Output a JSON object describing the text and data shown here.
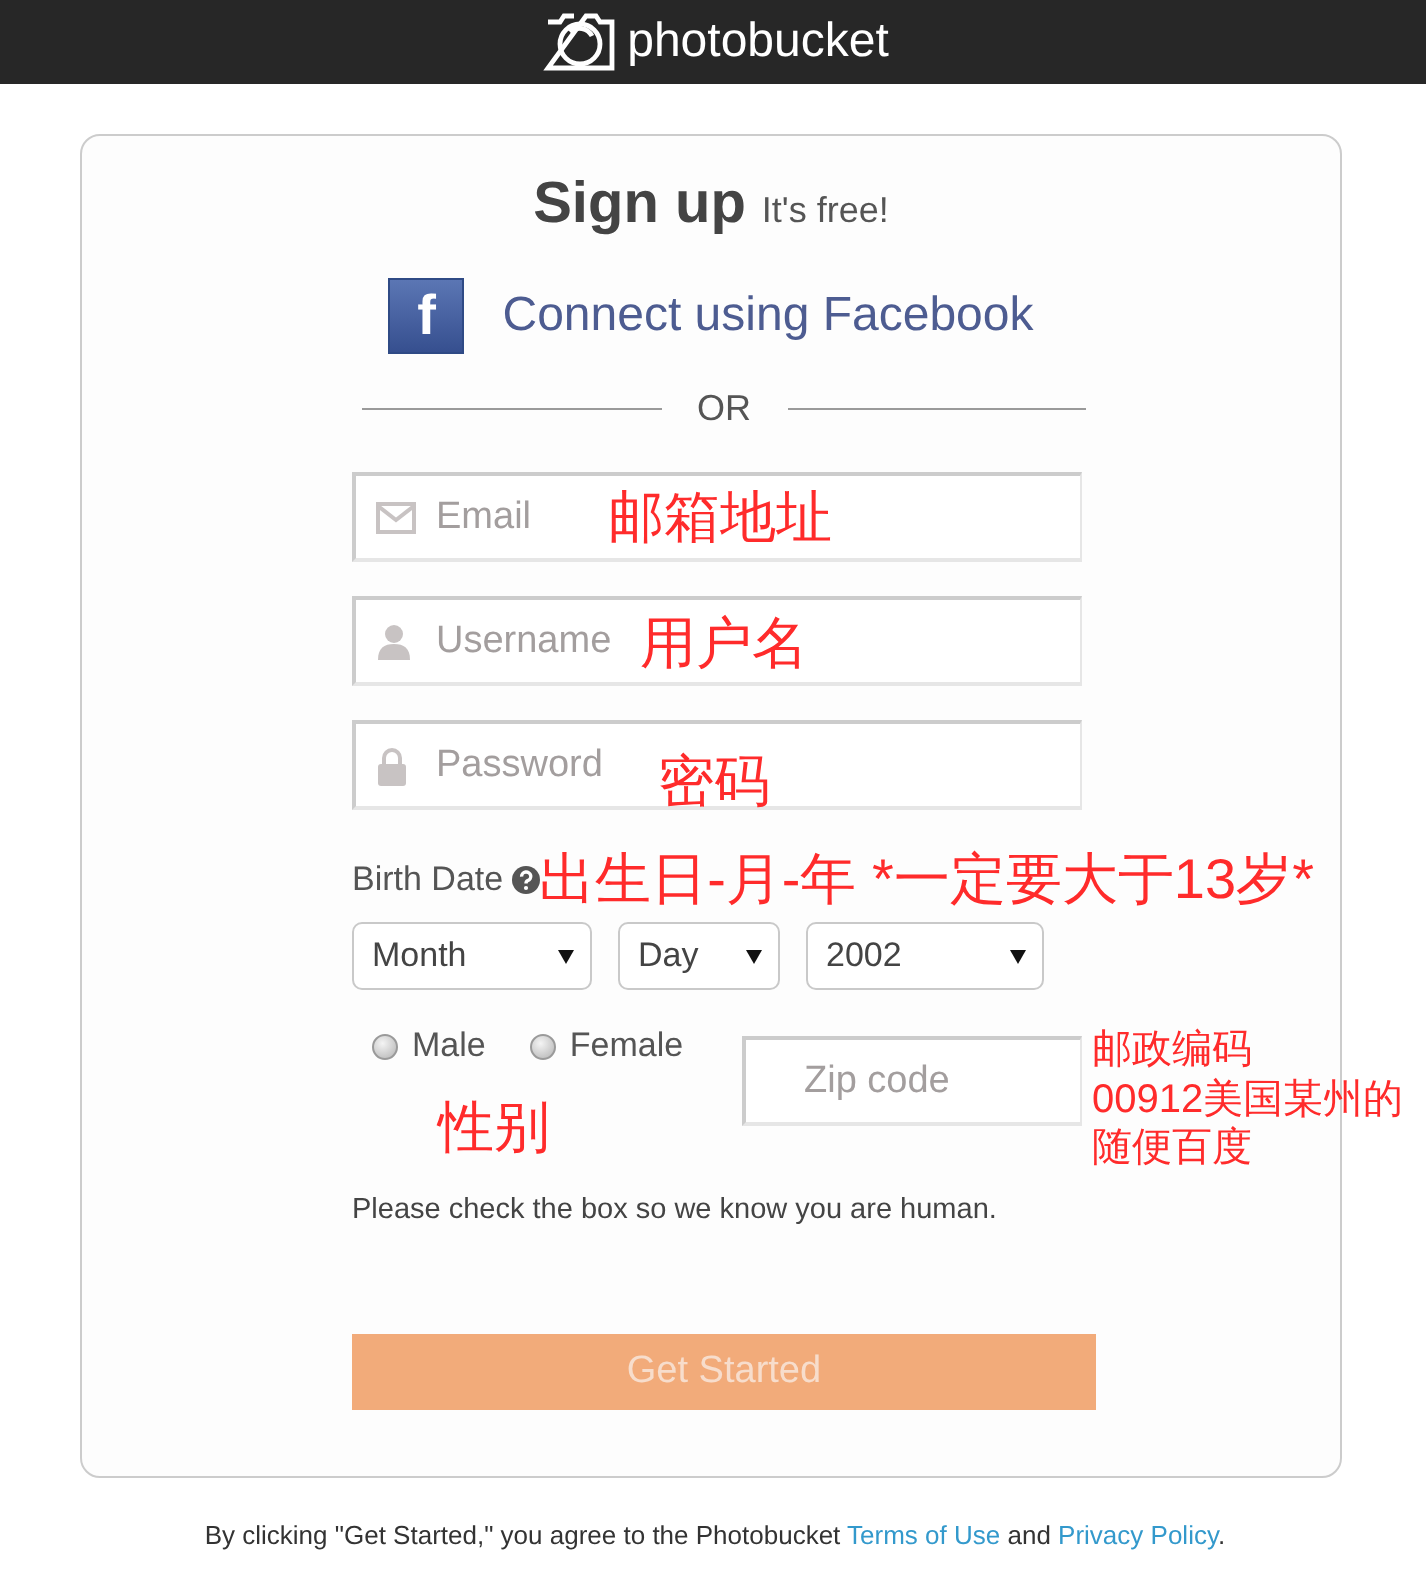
{
  "header": {
    "logo_text": "photobucket"
  },
  "signup": {
    "title": "Sign up",
    "subtitle": "It's free!"
  },
  "facebook": {
    "icon_letter": "f",
    "label": "Connect using Facebook"
  },
  "divider": "OR",
  "fields": [
    {
      "kind": "email",
      "placeholder": "Email",
      "annotation": "邮箱地址"
    },
    {
      "kind": "username",
      "placeholder": "Username",
      "annotation": "用户名"
    },
    {
      "kind": "password",
      "placeholder": "Password",
      "annotation": "密码"
    }
  ],
  "birth_date": {
    "label": "Birth Date",
    "annotation": "出生日-月-年 *一定要大于13岁*",
    "selects": [
      {
        "kind": "month",
        "value": "Month"
      },
      {
        "kind": "day",
        "value": "Day"
      },
      {
        "kind": "year",
        "value": "2002"
      }
    ]
  },
  "gender": {
    "options": [
      {
        "label": "Male",
        "selected": false
      },
      {
        "label": "Female",
        "selected": false
      }
    ],
    "annotation": "性别"
  },
  "zip": {
    "placeholder": "Zip code",
    "annotation_lines": [
      "邮政编码",
      "00912美国某州的",
      "随便百度"
    ]
  },
  "captcha_note": "Please check the box so we know you are human.",
  "submit": {
    "label": "Get Started",
    "disabled": true
  },
  "footer": {
    "parts": [
      {
        "kind": "text",
        "text": "By clicking \"Get Started,\" you agree to the Photobucket "
      },
      {
        "kind": "link",
        "text": "Terms of Use"
      },
      {
        "kind": "text",
        "text": " and "
      },
      {
        "kind": "link",
        "text": "Privacy Policy"
      },
      {
        "kind": "text",
        "text": "."
      }
    ]
  }
}
